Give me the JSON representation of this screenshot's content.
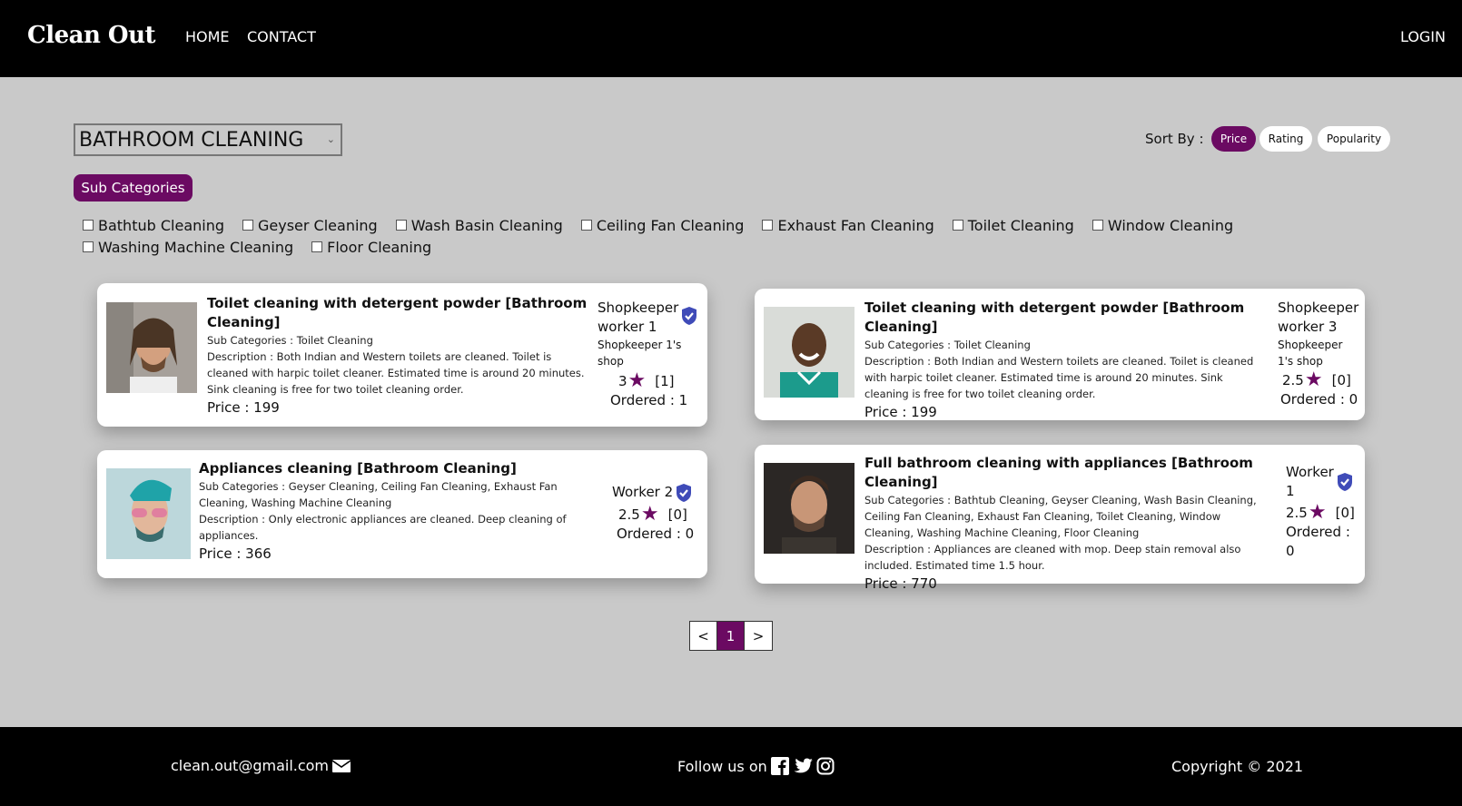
{
  "header": {
    "logo": "Clean Out",
    "nav": {
      "home": "HOME",
      "contact": "CONTACT",
      "login": "LOGIN"
    }
  },
  "filters": {
    "category_selected": "BATHROOM CLEANING",
    "sort_label": "Sort By :",
    "sort_options": [
      "Price",
      "Rating",
      "Popularity"
    ],
    "sort_active": "Price",
    "subcategories_button": "Sub Categories",
    "subcategories_row1": [
      "Bathtub Cleaning",
      "Geyser Cleaning",
      "Wash Basin Cleaning",
      "Ceiling Fan Cleaning",
      "Exhaust Fan Cleaning",
      "Toilet Cleaning",
      "Window Cleaning"
    ],
    "subcategories_row2": [
      "Washing Machine Cleaning",
      "Floor Cleaning"
    ]
  },
  "cards": [
    {
      "title": "Toilet cleaning with detergent powder [Bathroom Cleaning]",
      "sub": "Sub Categories : Toilet Cleaning",
      "desc": "Description : Both Indian and Western toilets are cleaned. Toilet is cleaned with harpic toilet cleaner. Estimated time is around 20 minutes. Sink cleaning is free for two toilet cleaning order.",
      "price": "Price : 199",
      "worker": "Shopkeeper worker 1",
      "shop": "Shopkeeper 1's shop",
      "rating": "3",
      "reviews": "[1]",
      "ordered": "Ordered : 1",
      "verified": true
    },
    {
      "title": "Toilet cleaning with detergent powder [Bathroom Cleaning]",
      "sub": "Sub Categories : Toilet Cleaning",
      "desc": "Description : Both Indian and Western toilets are cleaned. Toilet is cleaned with harpic toilet cleaner. Estimated time is around 20 minutes. Sink cleaning is free for two toilet cleaning order.",
      "price": "Price : 199",
      "worker": "Shopkeeper worker 3",
      "shop": "Shopkeeper 1's shop",
      "rating": "2.5",
      "reviews": "[0]",
      "ordered": "Ordered : 0",
      "verified": false
    },
    {
      "title": "Appliances cleaning [Bathroom Cleaning]",
      "sub": "Sub Categories : Geyser Cleaning, Ceiling Fan Cleaning, Exhaust Fan Cleaning, Washing Machine Cleaning",
      "desc": "Description : Only electronic appliances are cleaned. Deep cleaning of appliances.",
      "price": "Price : 366",
      "worker": "Worker 2",
      "rating": "2.5",
      "reviews": "[0]",
      "ordered": "Ordered : 0",
      "verified": true
    },
    {
      "title": "Full bathroom cleaning with appliances [Bathroom Cleaning]",
      "sub": "Sub Categories : Bathtub Cleaning, Geyser Cleaning, Wash Basin Cleaning, Ceiling Fan Cleaning, Exhaust Fan Cleaning, Toilet Cleaning, Window Cleaning, Washing Machine Cleaning, Floor Cleaning",
      "desc": "Description : Appliances are cleaned with mop. Deep stain removal also included. Estimated time 1.5 hour.",
      "price": "Price : 770",
      "worker": "Worker 1",
      "rating": "2.5",
      "reviews": "[0]",
      "ordered": "Ordered : 0",
      "verified": true
    }
  ],
  "pagination": {
    "prev": "<",
    "current": "1",
    "next": ">"
  },
  "footer": {
    "email": "clean.out@gmail.com",
    "follow": "Follow us on",
    "copyright": "Copyright © 2021"
  },
  "colors": {
    "accent": "#6b0a62",
    "header_bg": "#000000",
    "page_bg": "#c9c9c9",
    "verified": "#3f4bb8"
  },
  "icons": [
    "mail-icon",
    "facebook-icon",
    "twitter-icon",
    "instagram-icon",
    "star-icon",
    "verified-badge-icon",
    "chevron-down-icon"
  ]
}
